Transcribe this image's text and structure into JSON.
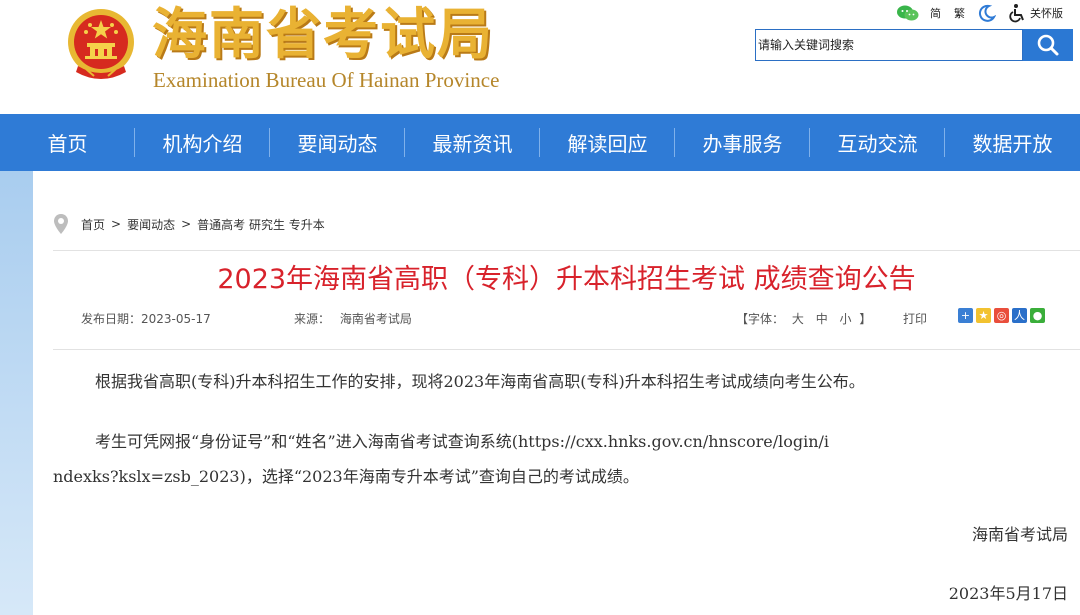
{
  "header": {
    "brand_cn": "海南省考试局",
    "brand_en": "Examination Bureau Of Hainan Province",
    "utils": {
      "wechat_icon": "wechat-icon",
      "simplified": "简",
      "traditional": "繁",
      "night_mode_icon": "moon-icon",
      "accessibility_icon": "wheelchair-icon",
      "accessible_label": "关怀版"
    },
    "search": {
      "placeholder": "请输入关键词搜索",
      "button_icon": "search-icon"
    }
  },
  "nav": {
    "items": [
      "首页",
      "机构介绍",
      "要闻动态",
      "最新资讯",
      "解读回应",
      "办事服务",
      "互动交流",
      "数据开放"
    ]
  },
  "breadcrumb": {
    "icon": "location-pin-icon",
    "home": "首页",
    "sep": ">",
    "level1": "要闻动态",
    "level2": "普通高考 研究生 专升本"
  },
  "article": {
    "title": "2023年海南省高职（专科）升本科招生考试 成绩查询公告",
    "publish_label": "发布日期：",
    "publish_date": "2023-05-17",
    "source_label": "来源：",
    "source": "海南省考试局",
    "font_size_label": "【字体：",
    "font_large": "大",
    "font_medium": "中",
    "font_small": "小",
    "font_close": "】",
    "print_label": "打印",
    "share_icons": [
      "plus-share-icon",
      "qzone-icon",
      "weibo-icon",
      "renren-icon",
      "wechat-share-icon"
    ],
    "paragraph1": "根据我省高职(专科)升本科招生工作的安排，现将2023年海南省高职(专科)升本科招生考试成绩向考生公布。",
    "paragraph2_line1": "考生可凭网报“身份证号”和“姓名”进入海南省考试查询系统(https://cxx.hnks.gov.cn/hnscore/login/i",
    "paragraph2_line2": "ndexks?kslx=zsb_2023)，选择“2023年海南专升本考试”查询自己的考试成绩。",
    "signature": "海南省考试局",
    "date": "2023年5月17日"
  },
  "colors": {
    "nav_bg": "#2f7bd6",
    "title_red": "#d8222b",
    "brand_gold": "#e9b233"
  }
}
